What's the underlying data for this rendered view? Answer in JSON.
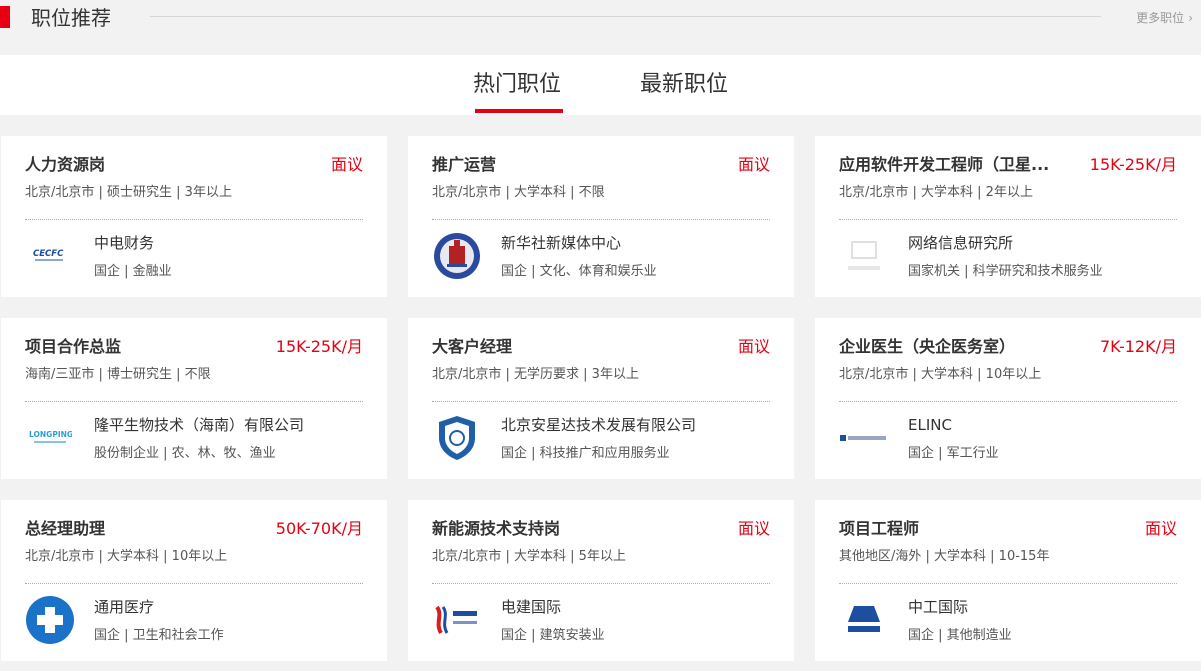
{
  "header": {
    "title": "职位推荐",
    "more": "更多职位"
  },
  "tabs": [
    {
      "label": "热门职位"
    },
    {
      "label": "最新职位"
    }
  ],
  "jobs": [
    {
      "title": "人力资源岗",
      "salary": "面议",
      "meta": "北京/北京市 | 硕士研究生 | 3年以上",
      "company": "中电财务",
      "tags": "国企 | 金融业",
      "logo": "cecfc-logo"
    },
    {
      "title": "推广运营",
      "salary": "面议",
      "meta": "北京/北京市 | 大学本科 | 不限",
      "company": "新华社新媒体中心",
      "tags": "国企 | 文化、体育和娱乐业",
      "logo": "xinhua-logo"
    },
    {
      "title": "应用软件开发工程师（卫星...",
      "salary": "15K-25K/月",
      "meta": "北京/北京市 | 大学本科 | 2年以上",
      "company": "网络信息研究所",
      "tags": "国家机关 | 科学研究和技术服务业",
      "logo": "institute-logo"
    },
    {
      "title": "项目合作总监",
      "salary": "15K-25K/月",
      "meta": "海南/三亚市 | 博士研究生 | 不限",
      "company": "隆平生物技术（海南）有限公司",
      "tags": "股份制企业 | 农、林、牧、渔业",
      "logo": "longping-logo"
    },
    {
      "title": "大客户经理",
      "salary": "面议",
      "meta": "北京/北京市 | 无学历要求 | 3年以上",
      "company": "北京安星达技术发展有限公司",
      "tags": "国企 | 科技推广和应用服务业",
      "logo": "shield-logo"
    },
    {
      "title": "企业医生（央企医务室）",
      "salary": "7K-12K/月",
      "meta": "北京/北京市 | 大学本科 | 10年以上",
      "company": "ELINC",
      "tags": "国企 | 军工行业",
      "logo": "elinc-logo"
    },
    {
      "title": "总经理助理",
      "salary": "50K-70K/月",
      "meta": "北京/北京市 | 大学本科 | 10年以上",
      "company": "通用医疗",
      "tags": "国企 | 卫生和社会工作",
      "logo": "gm-logo"
    },
    {
      "title": "新能源技术支持岗",
      "salary": "面议",
      "meta": "北京/北京市 | 大学本科 | 5年以上",
      "company": "电建国际",
      "tags": "国企 | 建筑安装业",
      "logo": "powerchina-logo"
    },
    {
      "title": "项目工程师",
      "salary": "面议",
      "meta": "其他地区/海外 | 大学本科 | 10-15年",
      "company": "中工国际",
      "tags": "国企 | 其他制造业",
      "logo": "sinomach-logo"
    }
  ],
  "colors": {
    "accent": "#e60012",
    "background": "#f2f2f2",
    "card": "#ffffff"
  }
}
